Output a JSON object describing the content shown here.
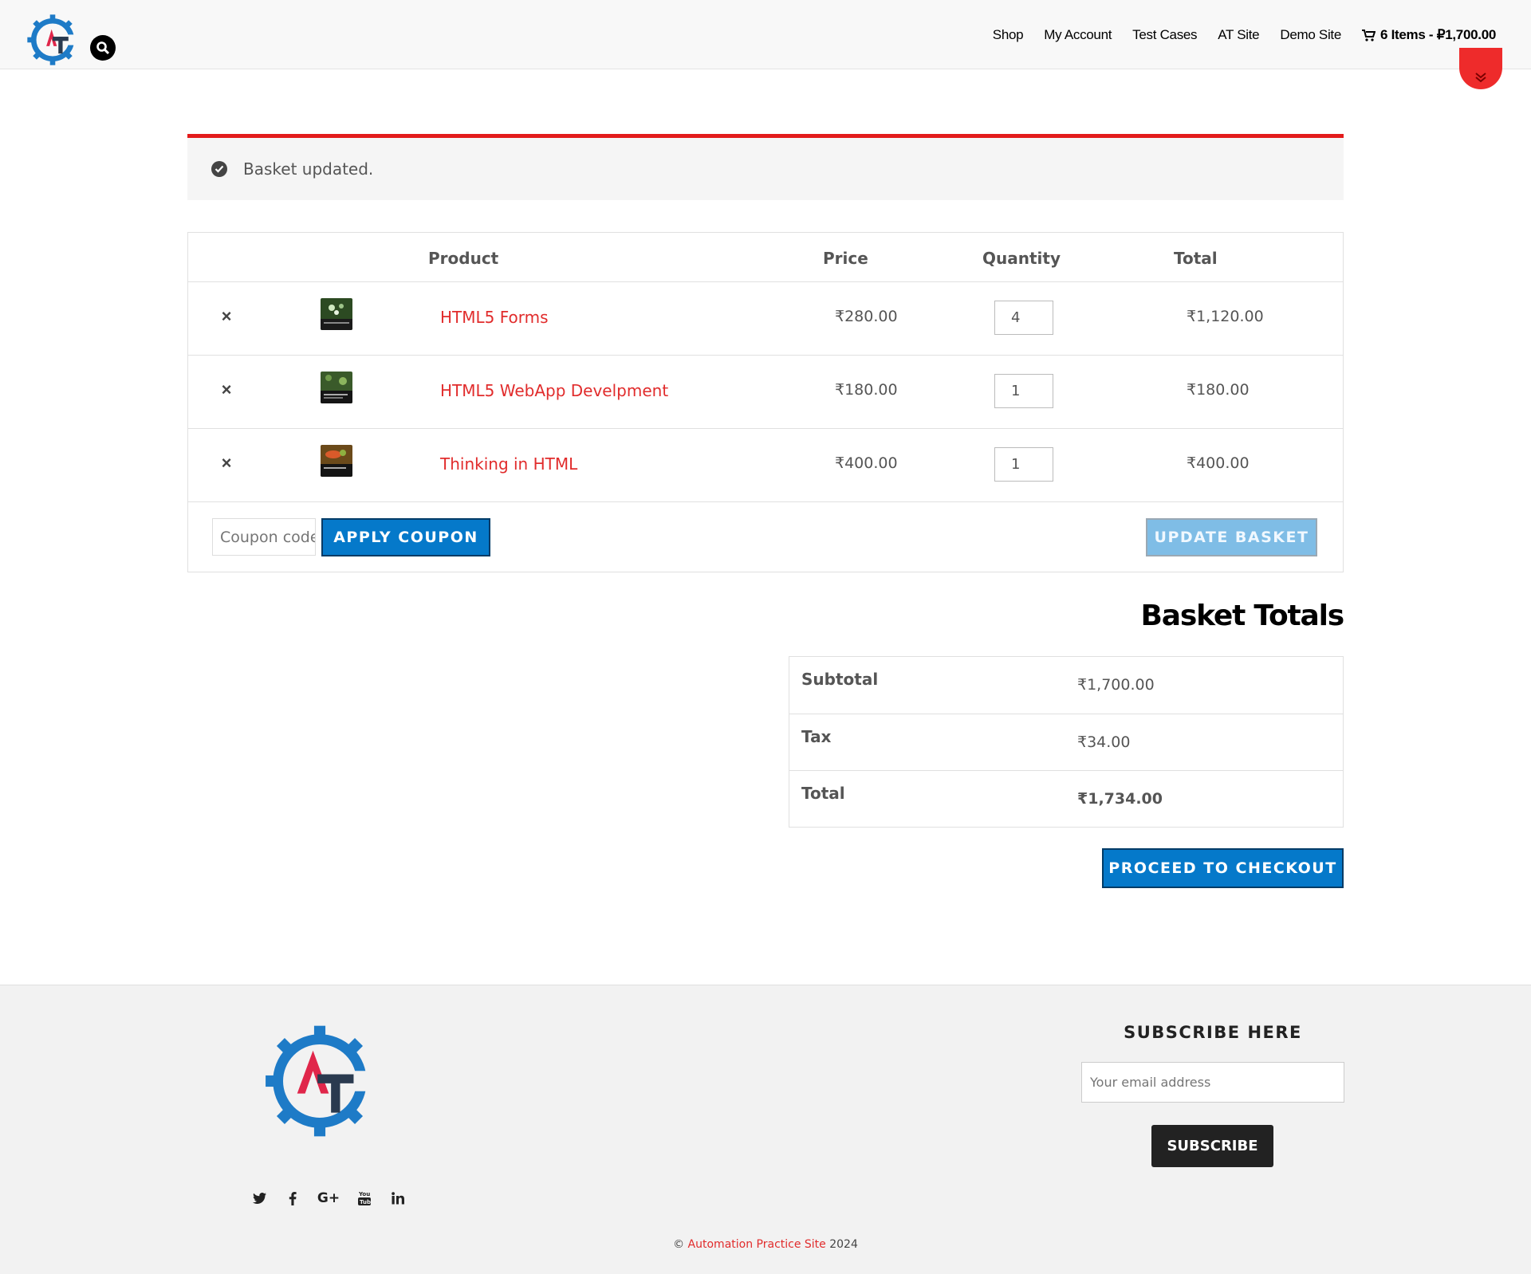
{
  "header": {
    "nav": [
      "Shop",
      "My Account",
      "Test Cases",
      "AT Site",
      "Demo Site"
    ],
    "cart_label": "6 Items - ₽1,700.00"
  },
  "notice": {
    "message": "Basket updated."
  },
  "cart": {
    "columns": {
      "product": "Product",
      "price": "Price",
      "quantity": "Quantity",
      "total": "Total"
    },
    "items": [
      {
        "name": "HTML5 Forms",
        "price": "₹280.00",
        "qty": "4",
        "total": "₹1,120.00"
      },
      {
        "name": "HTML5 WebApp Develpment",
        "price": "₹180.00",
        "qty": "1",
        "total": "₹180.00"
      },
      {
        "name": "Thinking in HTML",
        "price": "₹400.00",
        "qty": "1",
        "total": "₹400.00"
      }
    ],
    "coupon_placeholder": "Coupon code",
    "apply_coupon": "APPLY COUPON",
    "update_basket": "UPDATE BASKET"
  },
  "totals": {
    "title": "Basket Totals",
    "subtotal_label": "Subtotal",
    "subtotal": "₹1,700.00",
    "tax_label": "Tax",
    "tax": "₹34.00",
    "total_label": "Total",
    "total": "₹1,734.00",
    "checkout": "PROCEED TO CHECKOUT"
  },
  "footer": {
    "subscribe_title": "SUBSCRIBE HERE",
    "email_placeholder": "Your email address",
    "subscribe_button": "SUBSCRIBE",
    "social_icons": [
      "twitter-icon",
      "facebook-icon",
      "google-plus-icon",
      "youtube-icon",
      "linkedin-icon"
    ],
    "copyright_prefix": "© ",
    "copyright_link": "Automation Practice Site",
    "copyright_year": " 2024"
  },
  "colors": {
    "accent_red": "#e31b1b",
    "button_blue": "#0579ca",
    "link_red": "#e12c2c"
  }
}
